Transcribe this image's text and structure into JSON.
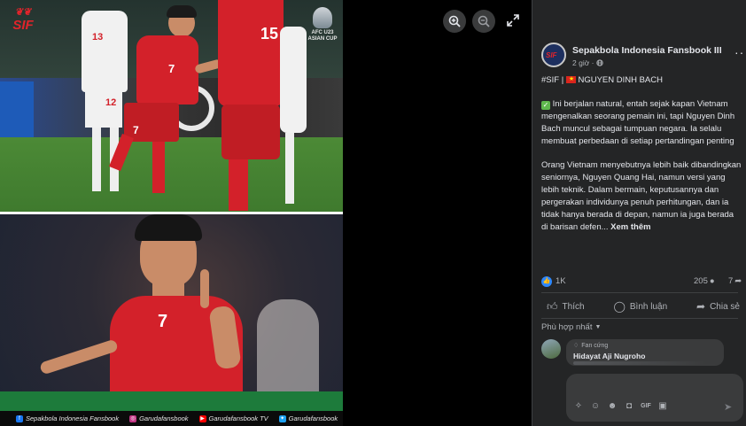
{
  "viewer": {
    "zoom_in_icon": "zoom-in-icon",
    "zoom_out_icon": "zoom-out-icon",
    "fullscreen_icon": "expand-icon"
  },
  "photo": {
    "sif_logo_text": "SIF",
    "afc_badge_text": "AFC U23 ASIAN CUP",
    "jersey_numbers": [
      "13",
      "7",
      "15",
      "12",
      "7"
    ],
    "credits": [
      {
        "icon": "facebook-icon",
        "color": "#1877f2",
        "text": "Sepakbola Indonesia Fansbook"
      },
      {
        "icon": "instagram-icon",
        "color": "#c13584",
        "text": "Garudafansbook"
      },
      {
        "icon": "youtube-icon",
        "color": "#ff0000",
        "text": "Garudafansbook TV"
      },
      {
        "icon": "twitter-icon",
        "color": "#1da1f2",
        "text": "Garudafansbook"
      }
    ]
  },
  "post": {
    "page_name": "Sepakbola Indonesia Fansbook III",
    "time": "2 giờ ·",
    "privacy_icon": "globe-icon",
    "headline_tag": "#SIF |",
    "headline_name": "NGUYEN DINH BACH",
    "para1": "Ini berjalan natural, entah sejak kapan Vietnam mengenalkan seorang pemain ini, tapi Nguyen Dinh Bach muncul sebagai tumpuan negara. Ia selalu membuat perbedaan di setiap pertandingan penting",
    "para2": "Orang Vietnam menyebutnya lebih baik dibandingkan seniornya, Nguyen Quang Hai, namun versi yang lebih teknik. Dalam bermain, keputusannya dan pergerakan individunya penuh perhitungan, dan ia tidak hanya berada di depan, namun ia juga berada di barisan defen...",
    "see_more": "Xem thêm"
  },
  "stats": {
    "likes": "1K",
    "comments": "205",
    "shares": "7"
  },
  "actions": {
    "like": "Thích",
    "comment": "Bình luận",
    "share": "Chia sẻ"
  },
  "comments": {
    "sort_label": "Phù hợp nhất",
    "items": [
      {
        "badge": "Fan cứng",
        "name": "Hidayat Aji Nugroho"
      }
    ]
  },
  "composer": {
    "icons": [
      "sticker-icon",
      "avatar-icon",
      "emoji-icon",
      "camera-icon",
      "gif-icon",
      "sticker-icon"
    ]
  },
  "colors": {
    "panel_bg": "#242526",
    "accent_blue": "#2d88ff",
    "vietnam_red": "#d3212a"
  }
}
